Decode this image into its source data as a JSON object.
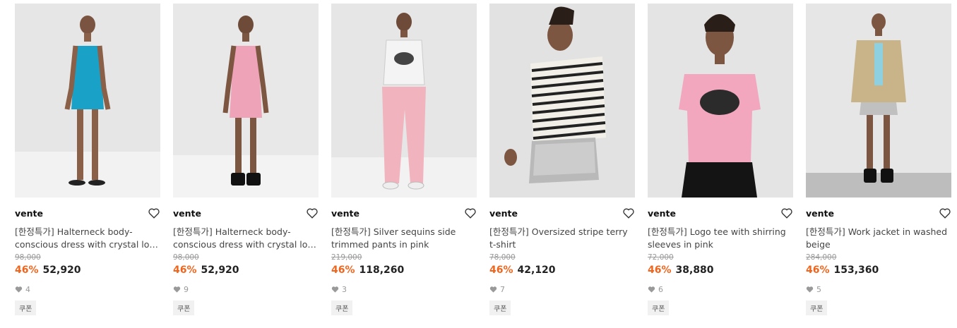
{
  "accent_color": "#f0651e",
  "products": [
    {
      "brand": "vente",
      "name": "[한정특가] Halterneck body-conscious dress with crystal logo in blue",
      "original_price": "98,000",
      "discount": "46%",
      "price": "52,920",
      "likes": "4",
      "coupon": "쿠폰",
      "image": "model-blue-dress"
    },
    {
      "brand": "vente",
      "name": "[한정특가] Halterneck body-conscious dress with crystal logo in pink",
      "original_price": "98,000",
      "discount": "46%",
      "price": "52,920",
      "likes": "9",
      "coupon": "쿠폰",
      "image": "model-pink-dress"
    },
    {
      "brand": "vente",
      "name": "[한정특가] Silver sequins side trimmed pants in pink",
      "original_price": "219,000",
      "discount": "46%",
      "price": "118,260",
      "likes": "3",
      "coupon": "쿠폰",
      "image": "model-pink-pants"
    },
    {
      "brand": "vente",
      "name": "[한정특가] Oversized stripe terry t-shirt",
      "original_price": "78,000",
      "discount": "46%",
      "price": "42,120",
      "likes": "7",
      "coupon": "쿠폰",
      "image": "model-stripe-tee"
    },
    {
      "brand": "vente",
      "name": "[한정특가] Logo tee with shirring sleeves in pink",
      "original_price": "72,000",
      "discount": "46%",
      "price": "38,880",
      "likes": "6",
      "coupon": "쿠폰",
      "image": "model-pink-logo-tee"
    },
    {
      "brand": "vente",
      "name": "[한정특가] Work jacket in washed beige",
      "original_price": "284,000",
      "discount": "46%",
      "price": "153,360",
      "likes": "5",
      "coupon": "쿠폰",
      "image": "model-beige-jacket"
    }
  ]
}
